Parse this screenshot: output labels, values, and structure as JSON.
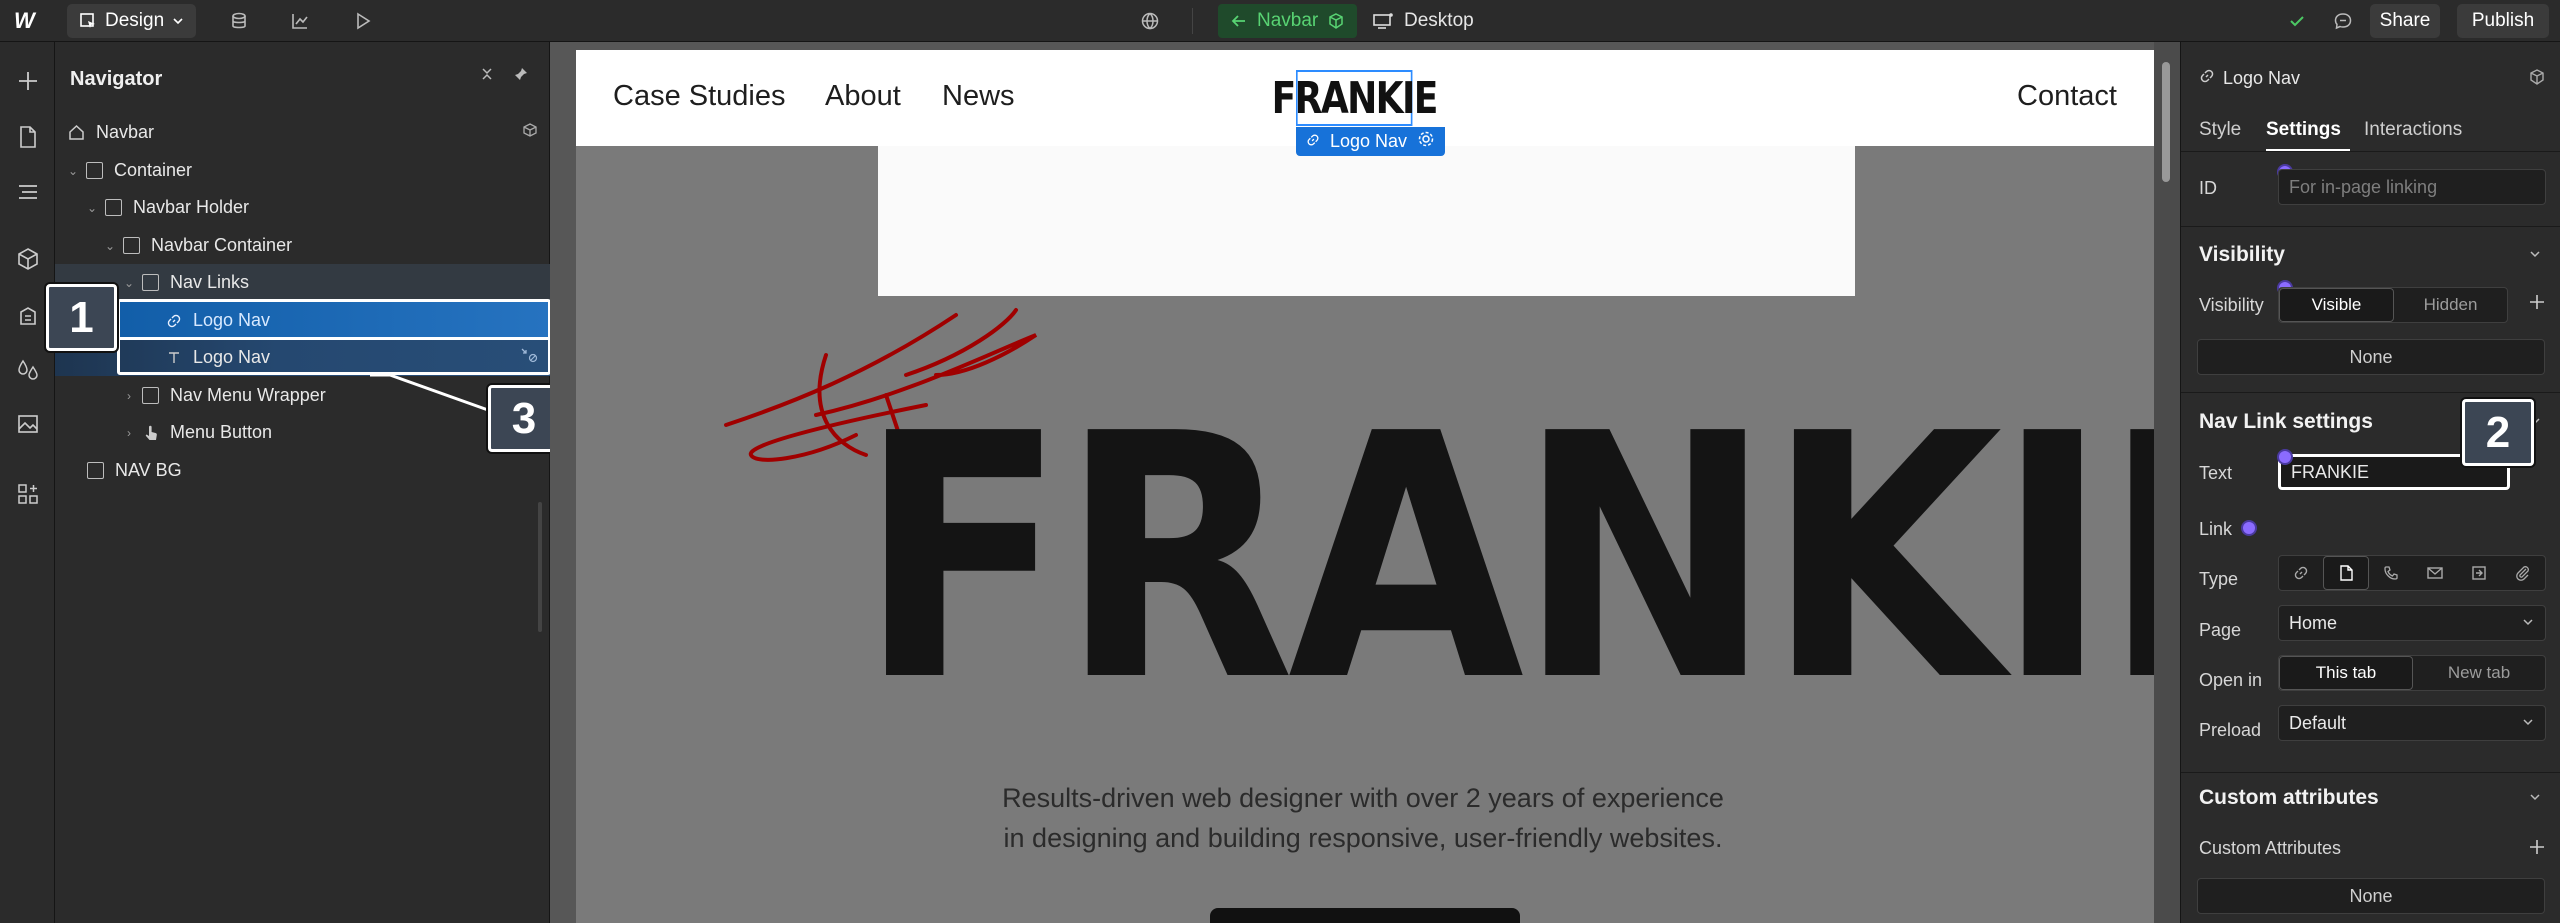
{
  "topbar": {
    "logo": "W",
    "design_label": "Design",
    "breadcrumb_label": "Navbar",
    "device_label": "Desktop",
    "share_label": "Share",
    "publish_label": "Publish"
  },
  "navigator": {
    "title": "Navigator",
    "tree": [
      {
        "label": "Navbar"
      },
      {
        "label": "Container"
      },
      {
        "label": "Navbar Holder"
      },
      {
        "label": "Navbar Container"
      },
      {
        "label": "Nav Links"
      },
      {
        "label": "Logo Nav"
      },
      {
        "label": "Logo Nav"
      },
      {
        "label": "Nav Menu Wrapper"
      },
      {
        "label": "Menu Button"
      },
      {
        "label": "NAV BG"
      }
    ]
  },
  "callouts": {
    "one": "1",
    "two": "2",
    "three": "3"
  },
  "canvas": {
    "nav_links": [
      "Case Studies",
      "About",
      "News"
    ],
    "contact": "Contact",
    "logo_text": "FRANKIE",
    "selected_label": "Logo Nav",
    "hero_title": "FRANKIE",
    "hero_desc_line1": "Results-driven web designer with over 2 years of experience",
    "hero_desc_line2": "in designing and building responsive, user-friendly websites."
  },
  "right_panel": {
    "element_name": "Logo Nav",
    "tabs": [
      "Style",
      "Settings",
      "Interactions"
    ],
    "id_label": "ID",
    "id_placeholder": "For in-page linking",
    "visibility_section": "Visibility",
    "visibility_label": "Visibility",
    "visible_option": "Visible",
    "hidden_option": "Hidden",
    "none_label": "None",
    "navlink_section": "Nav Link settings",
    "text_label": "Text",
    "text_value": "FRANKIE",
    "link_label": "Link",
    "type_label": "Type",
    "page_label": "Page",
    "page_value": "Home",
    "openin_label": "Open in",
    "this_tab": "This tab",
    "new_tab": "New tab",
    "preload_label": "Preload",
    "preload_value": "Default",
    "custom_attr_section": "Custom attributes",
    "custom_attr_label": "Custom Attributes",
    "custom_attr_none": "None"
  },
  "colors": {
    "accent_blue": "#1772d9",
    "breadcrumb_green": "#58d373",
    "signature_red": "#a00000",
    "purple_dot": "#8b6bff"
  }
}
